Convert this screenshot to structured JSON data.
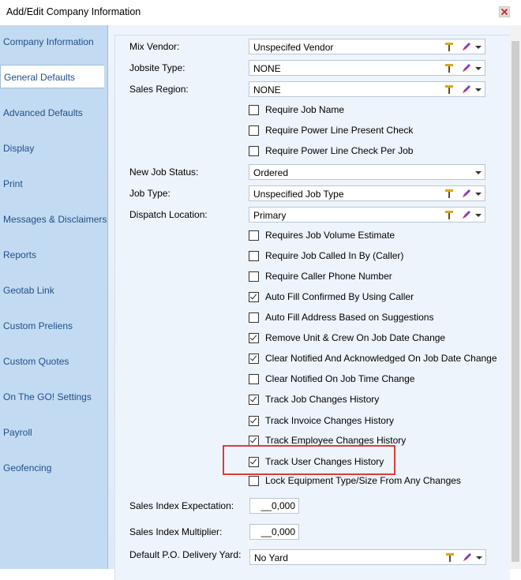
{
  "window": {
    "title": "Add/Edit Company Information"
  },
  "sidebar": {
    "items": [
      {
        "label": "Company Information"
      },
      {
        "label": "General Defaults",
        "active": true
      },
      {
        "label": "Advanced Defaults"
      },
      {
        "label": "Display"
      },
      {
        "label": "Print"
      },
      {
        "label": "Messages & Disclaimers"
      },
      {
        "label": "Reports"
      },
      {
        "label": "Geotab Link"
      },
      {
        "label": "Custom Preliens"
      },
      {
        "label": "Custom Quotes"
      },
      {
        "label": "On The GO! Settings"
      },
      {
        "label": "Payroll"
      },
      {
        "label": "Geofencing"
      }
    ]
  },
  "form": {
    "mix_vendor": {
      "label": "Mix Vendor:",
      "value": "Unspecifed Vendor"
    },
    "jobsite_type": {
      "label": "Jobsite Type:",
      "value": "NONE"
    },
    "sales_region": {
      "label": "Sales Region:",
      "value": "NONE"
    },
    "checks1": [
      {
        "label": "Require Job Name",
        "checked": false
      },
      {
        "label": "Require Power Line Present Check",
        "checked": false
      },
      {
        "label": "Require Power Line Check Per Job",
        "checked": false
      }
    ],
    "new_job_status": {
      "label": "New Job Status:",
      "value": "Ordered"
    },
    "job_type": {
      "label": "Job Type:",
      "value": "Unspecified Job Type"
    },
    "dispatch_location": {
      "label": "Dispatch Location:",
      "value": "Primary"
    },
    "checks2": [
      {
        "label": "Requires Job Volume Estimate",
        "checked": false
      },
      {
        "label": "Require Job Called In By (Caller)",
        "checked": false
      },
      {
        "label": "Require Caller Phone Number",
        "checked": false
      },
      {
        "label": "Auto Fill Confirmed By Using Caller",
        "checked": true
      },
      {
        "label": "Auto Fill Address Based on Suggestions",
        "checked": false
      },
      {
        "label": "Remove Unit & Crew On Job Date Change",
        "checked": true
      },
      {
        "label": "Clear Notified And Acknowledged On Job Date Change",
        "checked": true
      },
      {
        "label": "Clear Notified On Job Time Change",
        "checked": false
      },
      {
        "label": "Track Job Changes History",
        "checked": true
      },
      {
        "label": "Track Invoice Changes History",
        "checked": true
      },
      {
        "label": "Track Employee Changes History",
        "checked": true
      },
      {
        "label": "Track User Changes History",
        "checked": true
      },
      {
        "label": "Lock Equipment Type/Size From Any Changes",
        "checked": false
      }
    ],
    "sales_index_expectation": {
      "label": "Sales Index Expectation:",
      "value": "__0,000"
    },
    "sales_index_multiplier": {
      "label": "Sales Index Multiplier:",
      "value": "__0,000"
    },
    "default_po_yard": {
      "label": "Default P.O. Delivery Yard:",
      "value": "No Yard"
    }
  },
  "colors": {
    "highlight": "#e03a3a",
    "sidebar_bg": "#c3dbf2",
    "nav_text": "#1f4f8a"
  }
}
